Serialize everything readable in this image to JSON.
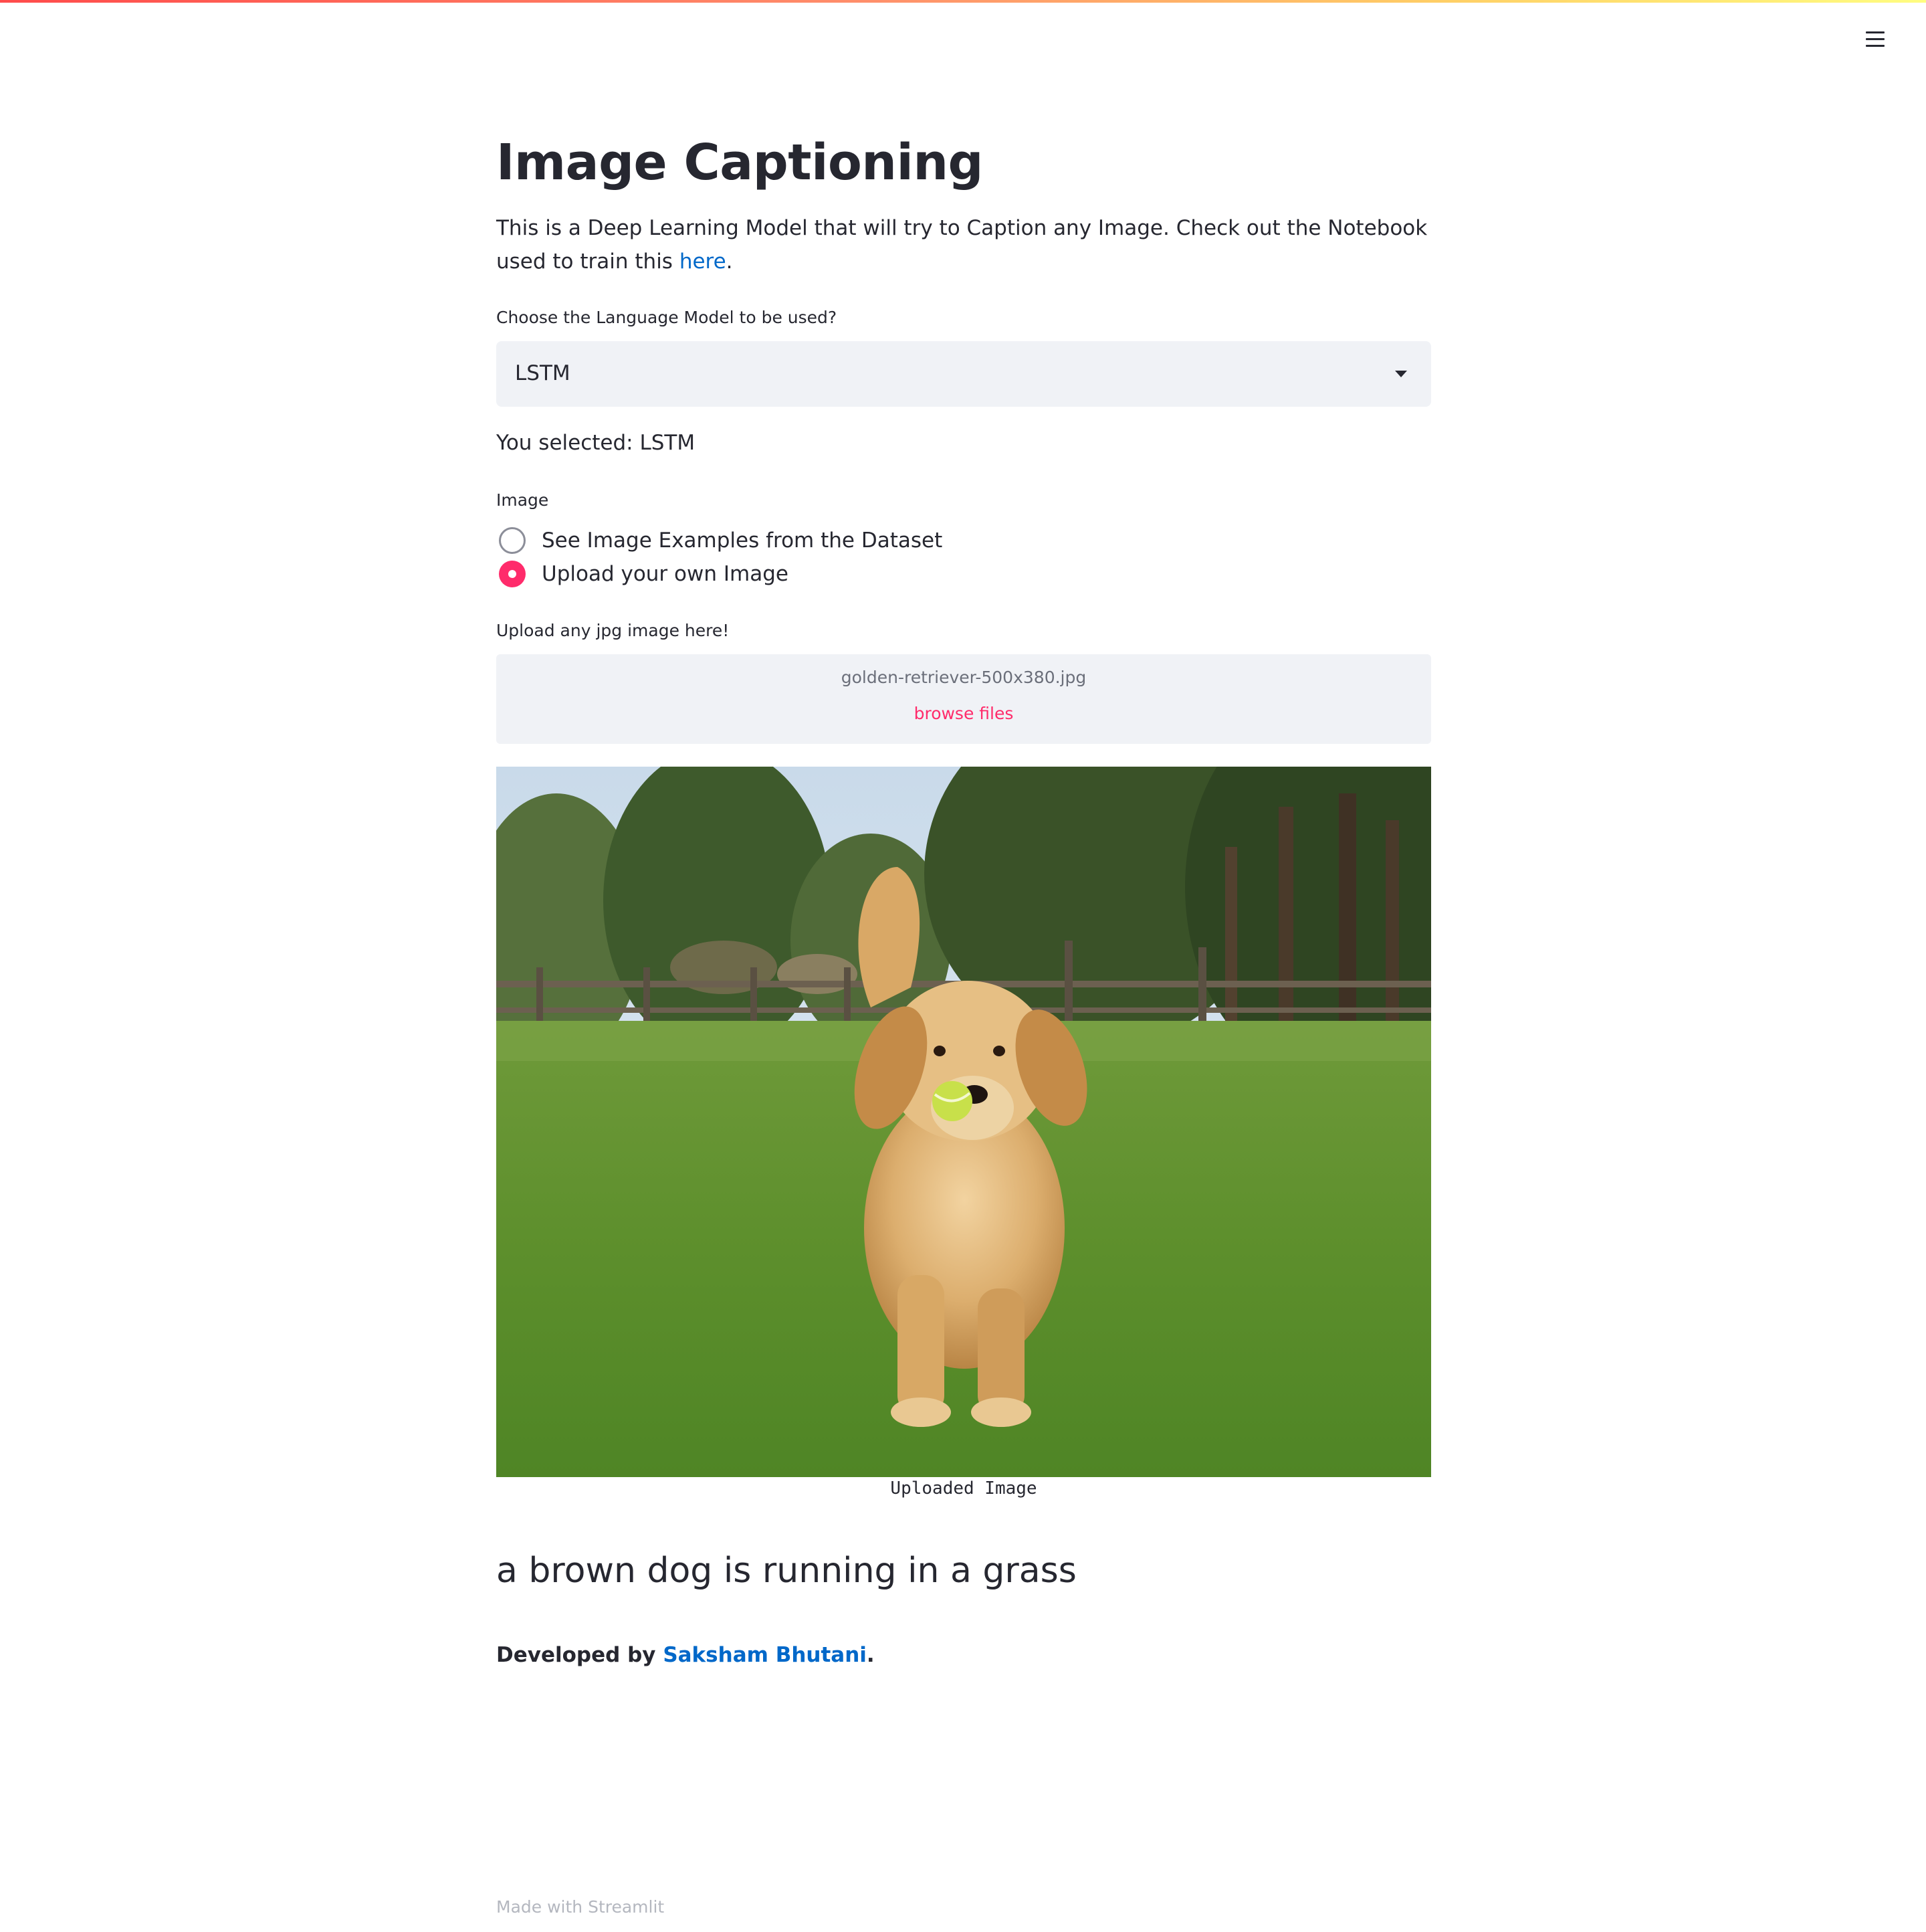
{
  "app": {
    "title": "Image Captioning",
    "accent_color": "#ff2b6b",
    "link_color": "#0068c9"
  },
  "intro": {
    "text": "This is a Deep Learning Model that will try to Caption any Image. Check out the Notebook used to train this ",
    "link_text": "here",
    "trailing": "."
  },
  "model_select": {
    "label": "Choose the Language Model to be used?",
    "value": "LSTM",
    "icon": "caret-down-icon"
  },
  "selection_feedback": "You selected: LSTM",
  "image_source": {
    "label": "Image",
    "options": [
      {
        "label": "See Image Examples from the Dataset",
        "selected": false
      },
      {
        "label": "Upload your own Image",
        "selected": true
      }
    ]
  },
  "uploader": {
    "label": "Upload any jpg image here!",
    "file_name": "golden-retriever-500x380.jpg",
    "browse_label": "browse files"
  },
  "uploaded_image": {
    "caption": "Uploaded Image"
  },
  "generated_caption": "a brown dog is running in a grass",
  "developer": {
    "prefix": "Developed by ",
    "name": "Saksham Bhutani",
    "suffix": "."
  },
  "footer": "Made with Streamlit",
  "menu": {
    "icon": "hamburger-menu-icon"
  }
}
